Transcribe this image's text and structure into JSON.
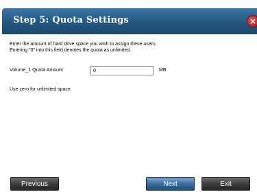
{
  "header": {
    "title": "Step 5: Quota Settings",
    "close_label": "×"
  },
  "content": {
    "description_line1": "Enter the amount of hard drive space you wish to assign these users.",
    "description_line2": "Entering \"0\" into this field denotes the quota as unlimited.",
    "quota_field": {
      "label": "Volume_1 Quota Amount",
      "value": "0",
      "unit": "MB"
    },
    "hint": "Use zero for unlimited space."
  },
  "buttons": {
    "previous": "Previous",
    "next": "Next",
    "exit": "Exit"
  },
  "colors": {
    "header": "#23577f",
    "next_button": "#3c6e9e",
    "close_button": "#c62828"
  }
}
